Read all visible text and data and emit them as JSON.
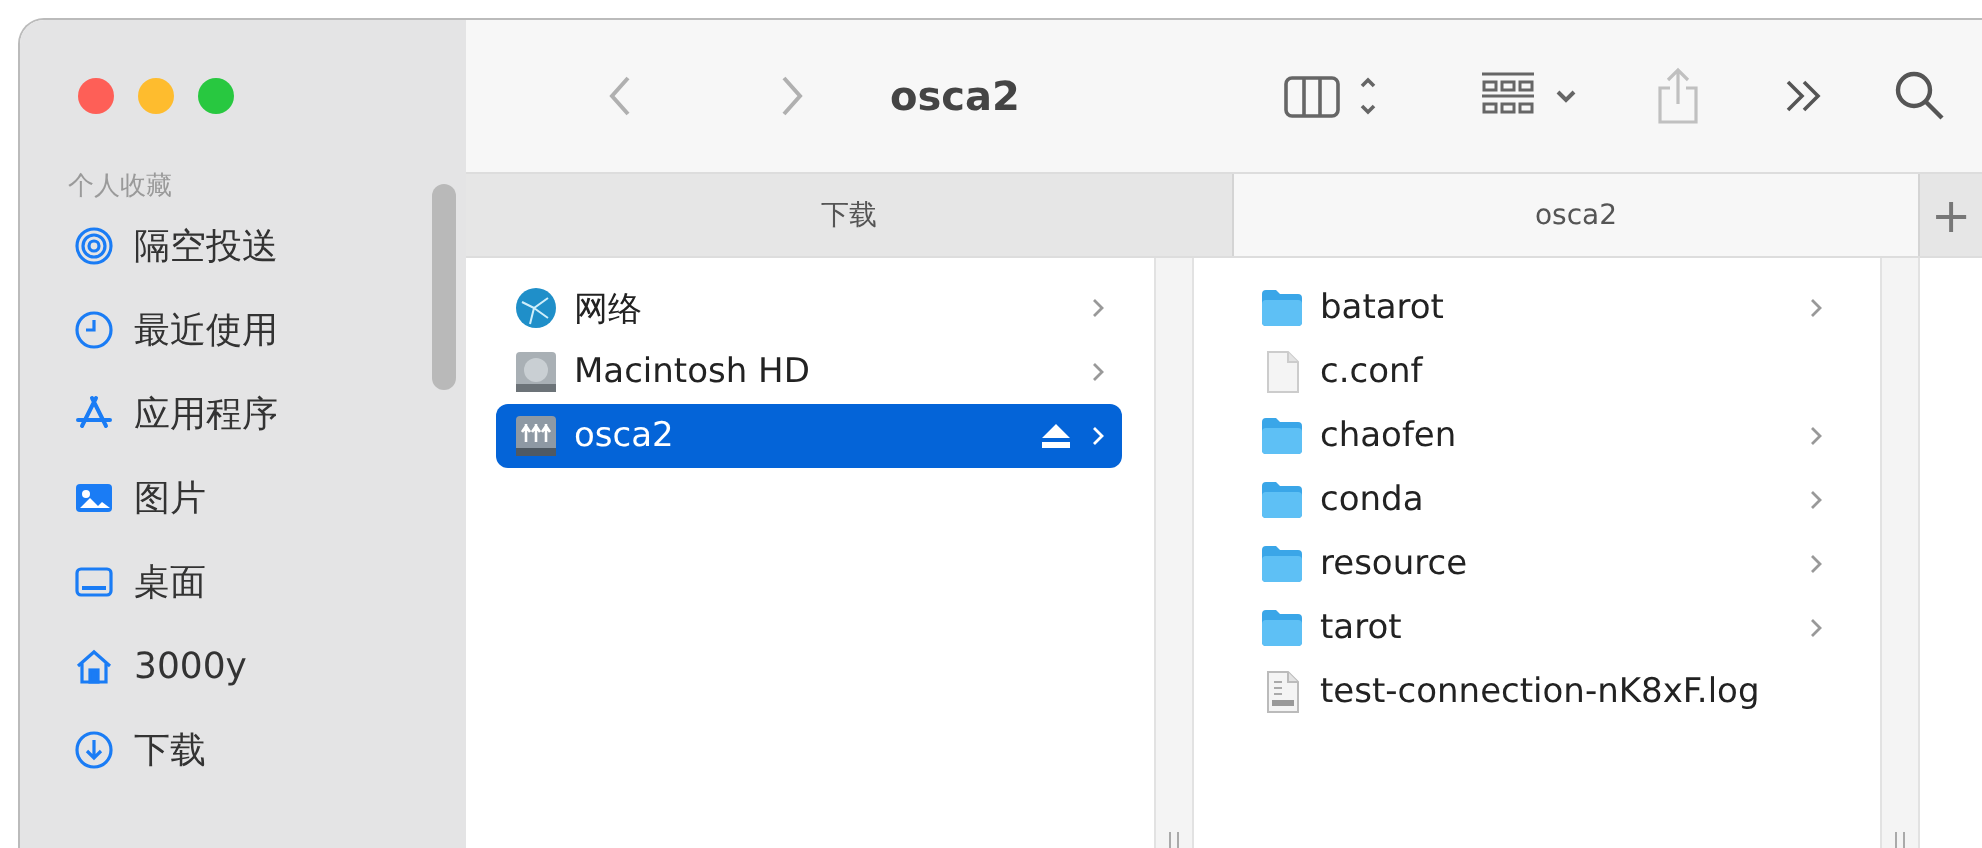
{
  "toolbar": {
    "title": "osca2"
  },
  "sidebar": {
    "section_title": "个人收藏",
    "items": [
      {
        "label": "隔空投送"
      },
      {
        "label": "最近使用"
      },
      {
        "label": "应用程序"
      },
      {
        "label": "图片"
      },
      {
        "label": "桌面"
      },
      {
        "label": "3000y"
      },
      {
        "label": "下载"
      }
    ]
  },
  "tabs": [
    {
      "label": "下载",
      "selected": false
    },
    {
      "label": "osca2",
      "selected": true
    }
  ],
  "add_tab": "+",
  "locations": [
    {
      "name": "网络",
      "kind": "network",
      "selected": false,
      "ejectable": false
    },
    {
      "name": "Macintosh HD",
      "kind": "disk",
      "selected": false,
      "ejectable": false
    },
    {
      "name": "osca2",
      "kind": "server",
      "selected": true,
      "ejectable": true
    }
  ],
  "files": [
    {
      "name": "batarot",
      "kind": "folder"
    },
    {
      "name": "c.conf",
      "kind": "file"
    },
    {
      "name": "chaofen",
      "kind": "folder"
    },
    {
      "name": "conda",
      "kind": "folder"
    },
    {
      "name": "resource",
      "kind": "folder"
    },
    {
      "name": "tarot",
      "kind": "folder"
    },
    {
      "name": "test-connection-nK8xF.log",
      "kind": "log"
    }
  ]
}
